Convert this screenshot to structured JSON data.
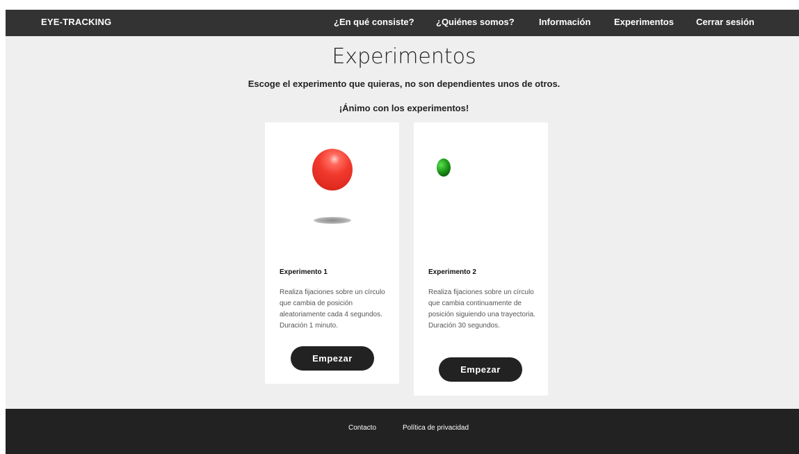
{
  "navbar": {
    "brand": "EYE-TRACKING",
    "items": [
      {
        "label": "¿En qué consiste?"
      },
      {
        "label": "¿Quiénes somos?"
      },
      {
        "label": "Información"
      },
      {
        "label": "Experimentos"
      },
      {
        "label": "Cerrar sesión"
      }
    ]
  },
  "main": {
    "title": "Experimentos",
    "intro": "Escoge el experimento que quieras, no son dependientes unos de otros.",
    "cheer": "¡Ánimo con los experimentos!",
    "cards": [
      {
        "title": "Experimento 1",
        "description": "Realiza fijaciones sobre un círculo que cambia de posición aleatoriamente cada 4 segundos. Duración 1 minuto.",
        "button": "Empezar",
        "visual": "red-sphere"
      },
      {
        "title": "Experimento 2",
        "description": "Realiza fijaciones sobre un círculo que cambia continuamente de posición siguiendo una trayectoria. Duración 30 segundos.",
        "button": "Empezar",
        "visual": "green-dot"
      }
    ]
  },
  "footer": {
    "links": [
      {
        "label": "Contacto"
      },
      {
        "label": "Política de privacidad"
      }
    ]
  },
  "colors": {
    "nav_bg": "#333333",
    "footer_bg": "#222222",
    "page_bg": "#efefef",
    "button_bg": "#222222",
    "red_ball": "#f23a2e",
    "green_ball": "#1f9a1a"
  }
}
